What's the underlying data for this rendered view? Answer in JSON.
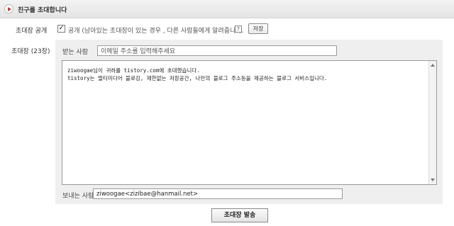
{
  "header": {
    "title": "친구를 초대합니다"
  },
  "publish": {
    "label": "초대장 공개",
    "checked_glyph": "✓",
    "checkbox_text": "공개 (남아있는 초대장이 있는 경우 , 다른 사람들에게 알려줍니다.",
    "help_glyph": "?",
    "save_label": "저장"
  },
  "invitation": {
    "label": "초대장 (23장)",
    "recipient_label": "받는 사람",
    "recipient_value": "이메일 주소를 입력해주세요",
    "message_line1": "ziwoogae님이 귀하를 tistory.com에 초대했습니다.",
    "message_line2": "tistory는 멀티미디어 블로깅, 제한없는 저장공간, 나만의 블로그 주소등을 제공하는 블로그 서비스입니다.",
    "sender_label": "보내는 사람",
    "sender_value": "ziwoogae<zizibae@hanmail.net>"
  },
  "actions": {
    "send_label": "초대장 발송"
  },
  "icons": {
    "title_bullet": "play-circle-icon",
    "help": "help-icon"
  },
  "colors": {
    "bullet_arrow": "#c0392b",
    "panel_bg": "#efefef"
  }
}
